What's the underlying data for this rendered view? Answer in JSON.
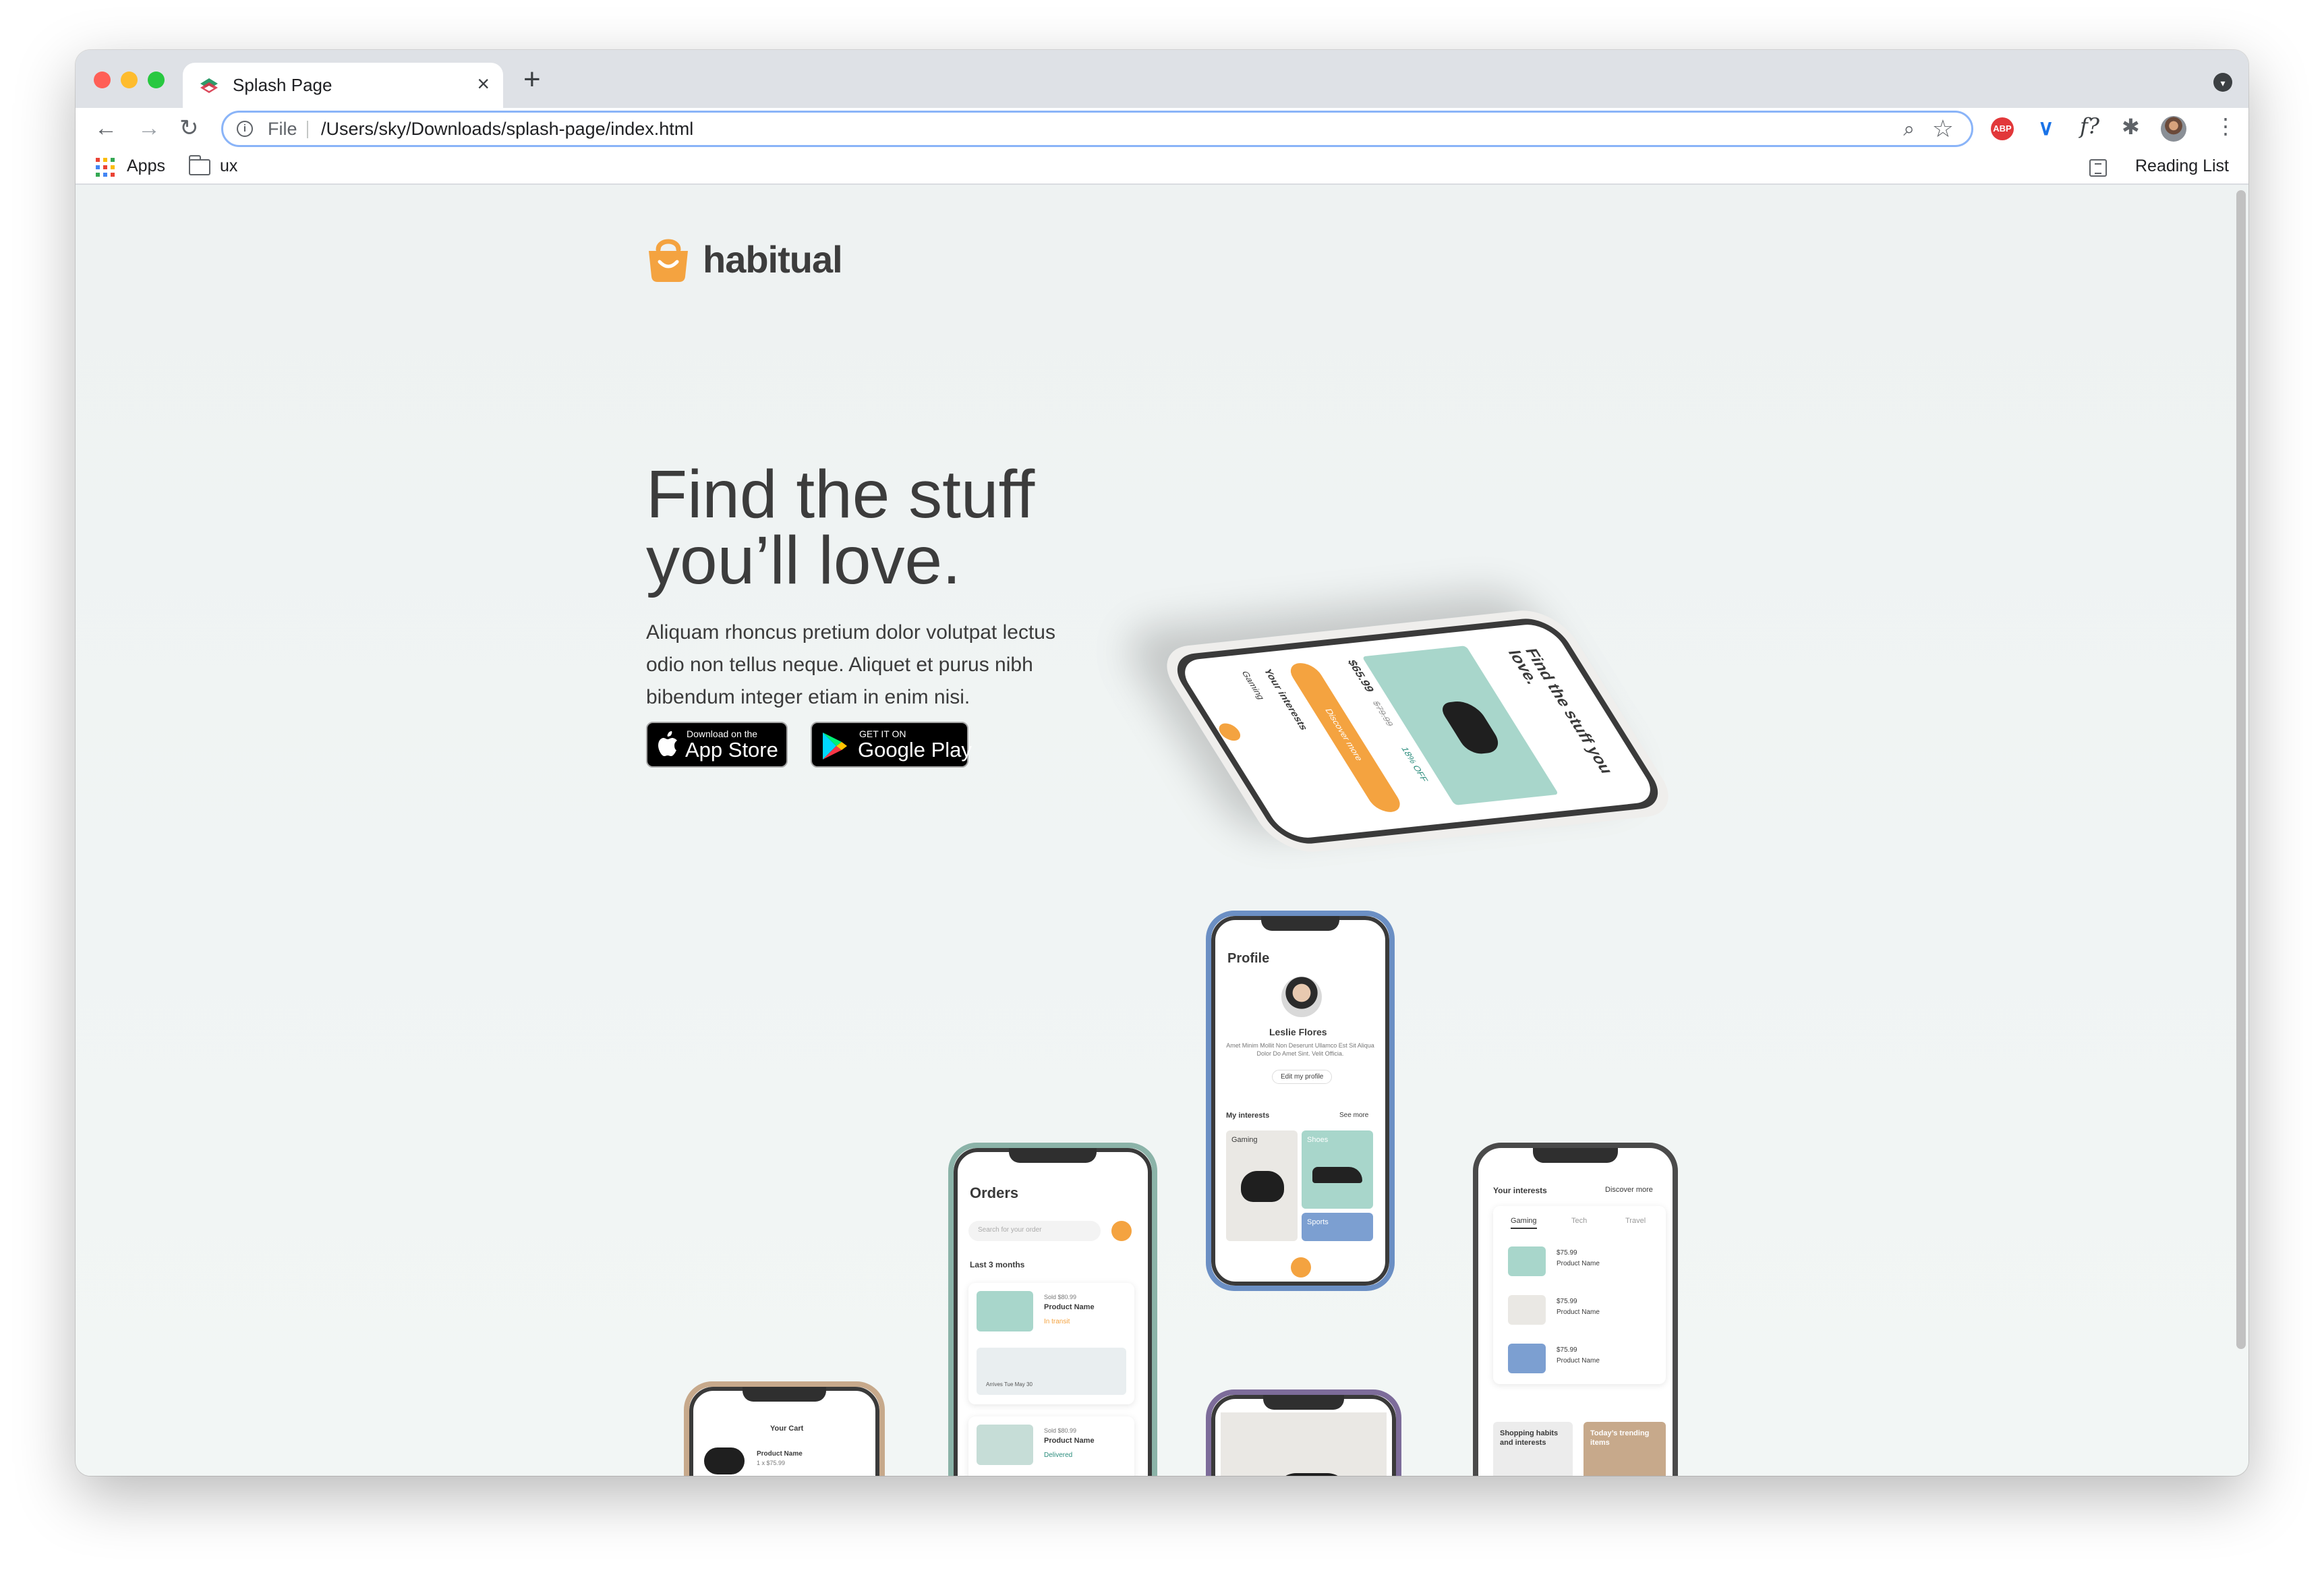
{
  "browser": {
    "tab_title": "Splash Page",
    "tab_close": "×",
    "new_tab": "+",
    "nav_back": "←",
    "nav_forward": "→",
    "nav_reload": "↻",
    "omnibox_scheme": "File",
    "omnibox_url": "/Users/sky/Downloads/splash-page/index.html",
    "extensions": {
      "abp": "ABP",
      "fx": "f?"
    },
    "bookmarks": [
      {
        "label": "Apps"
      },
      {
        "label": "ux"
      }
    ],
    "reading_list": "Reading List",
    "colors": {
      "accent": "#8ab4f8",
      "tabstrip": "#dee1e6"
    }
  },
  "page": {
    "logo_text": "habitual",
    "hero_title_line1": "Find the stuff",
    "hero_title_line2": "you’ll love.",
    "hero_body": "Aliquam rhoncus pretium dolor volutpat lectus odio non tellus neque. Aliquet et purus nibh bibendum integer etiam in enim nisi.",
    "badges": {
      "apple_small": "Download on the",
      "apple_big": "App Store",
      "google_small": "GET IT ON",
      "google_big": "Google Play"
    },
    "brand_color": "#f4a340"
  },
  "mockups": {
    "hero_phone": {
      "title": "Find the stuff you love.",
      "price": "$65.99",
      "price_old": "$79.99",
      "discount": "18% OFF",
      "section": "Your interests",
      "tab": "Gaming",
      "cta": "Discover more"
    },
    "profile": {
      "title": "Profile",
      "name": "Leslie Flores",
      "bio": "Amet Minim Mollit Non Deserunt Ullamco Est Sit Aliqua Dolor Do Amet Sint. Velit Officia.",
      "edit": "Edit my profile",
      "interests_label": "My interests",
      "see_more": "See more",
      "tiles": [
        "Gaming",
        "Shoes",
        "Sports"
      ]
    },
    "orders": {
      "title": "Orders",
      "search_placeholder": "Search for your order",
      "period": "Last 3 months",
      "items": [
        {
          "meta": "Sold $80.99",
          "name": "Product Name",
          "status": "In transit",
          "arrival": "Arrives Tue May 30"
        },
        {
          "meta": "Sold $80.99",
          "name": "Product Name",
          "status": "Delivered"
        }
      ]
    },
    "interests": {
      "title": "Your interests",
      "discover": "Discover more",
      "tabs": [
        "Gaming",
        "Tech",
        "Travel"
      ],
      "items": [
        {
          "price": "$75.99",
          "name": "Product Name"
        },
        {
          "price": "$75.99",
          "name": "Product Name"
        },
        {
          "price": "$75.99",
          "name": "Product Name"
        }
      ],
      "cards": [
        "Shopping habits and interests",
        "Today’s trending items"
      ]
    },
    "cart": {
      "title": "Your Cart",
      "item_name": "Product Name",
      "item_qty": "1 x $75.99"
    }
  }
}
